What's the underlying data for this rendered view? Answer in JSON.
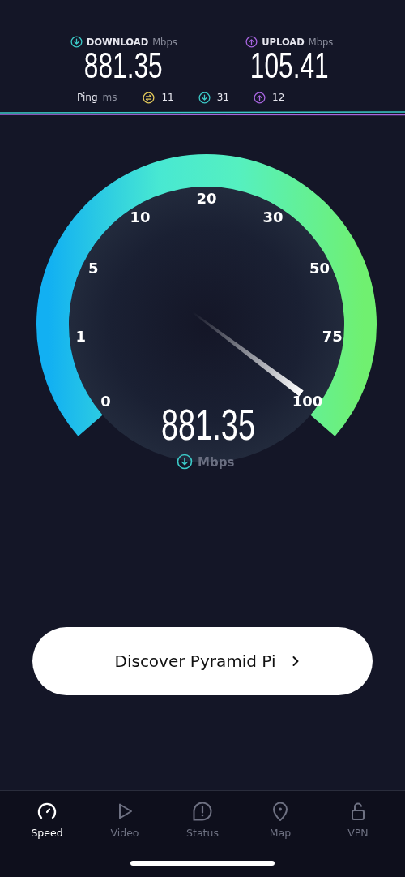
{
  "results": {
    "download": {
      "label": "DOWNLOAD",
      "unit": "Mbps",
      "value": "881.35"
    },
    "upload": {
      "label": "UPLOAD",
      "unit": "Mbps",
      "value": "105.41"
    },
    "ping": {
      "label": "Ping",
      "unit": "ms",
      "values": [
        {
          "kind": "idle",
          "value": "11"
        },
        {
          "kind": "download",
          "value": "31"
        },
        {
          "kind": "upload",
          "value": "12"
        }
      ]
    }
  },
  "gauge": {
    "scale": [
      "0",
      "1",
      "5",
      "10",
      "20",
      "30",
      "50",
      "75",
      "100"
    ],
    "value": "881.35",
    "unit": "Mbps"
  },
  "cta": {
    "label": "Discover Pyramid Pi"
  },
  "nav": [
    {
      "label": "Speed",
      "kind": "speed",
      "selected": true
    },
    {
      "label": "Video",
      "kind": "video",
      "selected": false
    },
    {
      "label": "Status",
      "kind": "status",
      "selected": false
    },
    {
      "label": "Map",
      "kind": "map",
      "selected": false
    },
    {
      "label": "VPN",
      "kind": "vpn",
      "selected": false
    }
  ]
}
